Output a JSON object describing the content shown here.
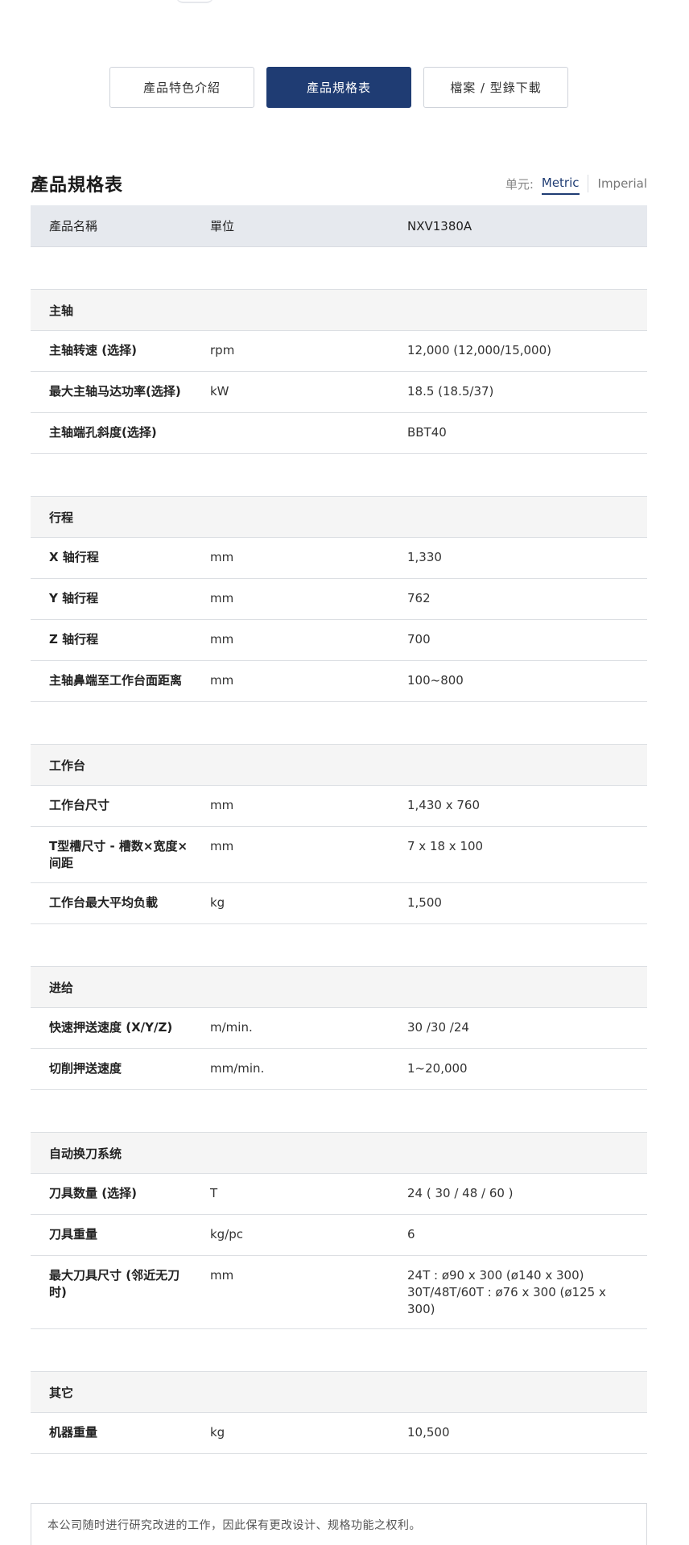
{
  "tabs": [
    {
      "label": "產品特色介紹",
      "active": false
    },
    {
      "label": "產品規格表",
      "active": true
    },
    {
      "label": "檔案 / 型錄下載",
      "active": false
    }
  ],
  "spec": {
    "title": "產品規格表",
    "unit_label": "单元:",
    "units": [
      {
        "label": "Metric",
        "active": true
      },
      {
        "label": "Imperial",
        "active": false
      }
    ]
  },
  "table": {
    "headers": [
      "產品名稱",
      "單位",
      "NXV1380A"
    ],
    "sections": [
      {
        "name": "主轴",
        "rows": [
          {
            "name": "主轴转速 (选择)",
            "unit": "rpm",
            "value": "12,000 (12,000/15,000)"
          },
          {
            "name": "最大主轴马达功率(选择)",
            "unit": "kW",
            "value": "18.5 (18.5/37)"
          },
          {
            "name": "主轴端孔斜度(选择)",
            "unit": "",
            "value": "BBT40"
          }
        ]
      },
      {
        "name": "行程",
        "rows": [
          {
            "name": "X 轴行程",
            "unit": "mm",
            "value": "1,330"
          },
          {
            "name": "Y 轴行程",
            "unit": "mm",
            "value": "762"
          },
          {
            "name": "Z 轴行程",
            "unit": "mm",
            "value": "700"
          },
          {
            "name": "主轴鼻端至工作台面距离",
            "unit": "mm",
            "value": "100~800"
          }
        ]
      },
      {
        "name": "工作台",
        "rows": [
          {
            "name": "工作台尺寸",
            "unit": "mm",
            "value": "1,430 x 760"
          },
          {
            "name": "T型槽尺寸 - 槽数×宽度×间距",
            "unit": "mm",
            "value": "7 x 18 x 100"
          },
          {
            "name": "工作台最大平均负載",
            "unit": "kg",
            "value": "1,500"
          }
        ]
      },
      {
        "name": "进给",
        "rows": [
          {
            "name": "快速押送速度 (X/Y/Z)",
            "unit": "m/min.",
            "value": "30 /30 /24"
          },
          {
            "name": "切削押送速度",
            "unit": "mm/min.",
            "value": "1~20,000"
          }
        ]
      },
      {
        "name": "自动换刀系统",
        "rows": [
          {
            "name": "刀具数量 (选择)",
            "unit": "T",
            "value": "24 ( 30 / 48 / 60 )"
          },
          {
            "name": "刀具重量",
            "unit": "kg/pc",
            "value": "6"
          },
          {
            "name": "最大刀具尺寸 (邻近无刀时)",
            "unit": "mm",
            "value": "24T : ø90 x 300 (ø140 x 300)\n30T/48T/60T : ø76 x 300 (ø125 x 300)"
          }
        ]
      },
      {
        "name": "其它",
        "rows": [
          {
            "name": "机器重量",
            "unit": "kg",
            "value": "10,500"
          }
        ]
      }
    ]
  },
  "note": "本公司随时进行研究改进的工作，因此保有更改设计、规格功能之权利。"
}
